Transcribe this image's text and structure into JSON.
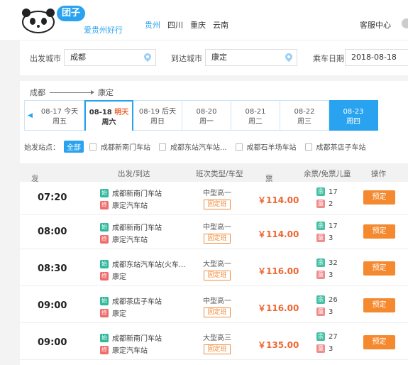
{
  "brand": {
    "logo_text": "团子",
    "slogan": "爱贵州好行"
  },
  "city_nav": [
    "贵州",
    "四川",
    "重庆",
    "云南"
  ],
  "service_label": "客服中心",
  "search": {
    "from_label": "出发城市",
    "from_value": "成都",
    "to_label": "到达城市",
    "to_value": "康定",
    "date_label": "乘车日期",
    "date_value": "2018-08-18"
  },
  "route": {
    "from": "成都",
    "to": "康定"
  },
  "dates": [
    {
      "date": "08-17",
      "tag": "今天",
      "weekday": "周五"
    },
    {
      "date": "08-18",
      "tag": "明天",
      "weekday": "周六"
    },
    {
      "date": "08-19",
      "tag": "后天",
      "weekday": "周日"
    },
    {
      "date": "08-20",
      "tag": "",
      "weekday": "周一"
    },
    {
      "date": "08-21",
      "tag": "",
      "weekday": "周二"
    },
    {
      "date": "08-22",
      "tag": "",
      "weekday": "周三"
    },
    {
      "date": "08-23",
      "tag": "",
      "weekday": "周四"
    }
  ],
  "station_filter": {
    "label": "始发站点：",
    "all_label": "全部",
    "options": [
      "成都新南门车站",
      "成都东站汽车站...",
      "成都石羊场车站",
      "成都茶店子车站"
    ]
  },
  "table_headers": {
    "time": "发车时间",
    "route": "出发/到达",
    "type": "班次类型/车型",
    "price": "票价",
    "seats": "余票/免票儿童",
    "action": "操作"
  },
  "badges": {
    "start": "始",
    "end": "终",
    "remaining": "余",
    "child": "童"
  },
  "trips": [
    {
      "time": "07:20",
      "from": "成都新南门车站",
      "to": "康定汽车站",
      "bus": "中型高一",
      "kind": "固定班",
      "price": "￥114.00",
      "remaining": "17",
      "child": "2",
      "action": "预定"
    },
    {
      "time": "08:00",
      "from": "成都新南门车站",
      "to": "康定汽车站",
      "bus": "中型高一",
      "kind": "固定班",
      "price": "￥114.00",
      "remaining": "17",
      "child": "3",
      "action": "预定"
    },
    {
      "time": "08:30",
      "from": "成都东站汽车站(火车...",
      "to": "康定",
      "bus": "大型高一",
      "kind": "固定班",
      "price": "￥116.00",
      "remaining": "32",
      "child": "3",
      "action": "预定"
    },
    {
      "time": "09:00",
      "from": "成都茶店子车站",
      "to": "康定",
      "bus": "中型高一",
      "kind": "固定班",
      "price": "￥116.00",
      "remaining": "26",
      "child": "3",
      "action": "预定"
    },
    {
      "time": "09:00",
      "from": "成都新南门车站",
      "to": "康定汽车站",
      "bus": "大型高三",
      "kind": "固定班",
      "price": "￥135.00",
      "remaining": "27",
      "child": "3",
      "action": "预定"
    }
  ],
  "colors": {
    "accent": "#29a3ef",
    "price": "#ee6633",
    "book_button": "#f4892f"
  }
}
